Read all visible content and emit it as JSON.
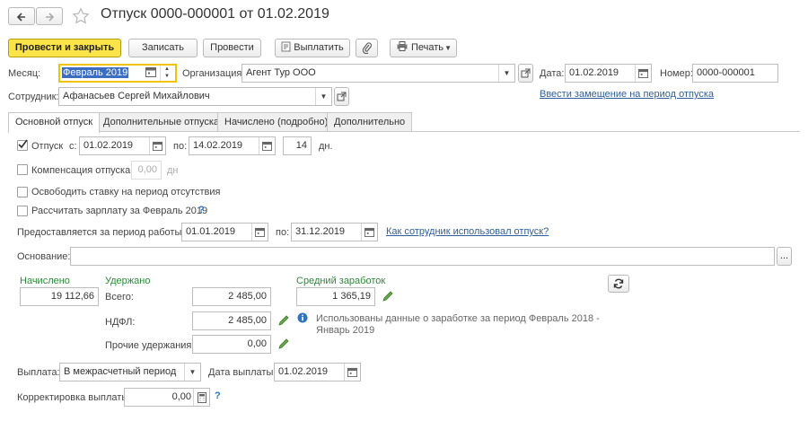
{
  "header": {
    "title": "Отпуск 0000-000001 от 01.02.2019",
    "back_icon": "arrow-left-icon",
    "forward_icon": "arrow-right-icon",
    "star_icon": "star-icon"
  },
  "toolbar": {
    "post_close": "Провести и закрыть",
    "save": "Записать",
    "post": "Провести",
    "pay": "Выплатить",
    "print": "Печать"
  },
  "top": {
    "month_label": "Месяц:",
    "month_value": "Февраль 2019",
    "org_label": "Организация:",
    "org_value": "Агент Тур ООО",
    "date_label": "Дата:",
    "date_value": "01.02.2019",
    "number_label": "Номер:",
    "number_value": "0000-000001",
    "employee_label": "Сотрудник:",
    "employee_value": "Афанасьев Сергей Михайлович",
    "substitution_link": "Ввести замещение на период отпуска"
  },
  "tabs": [
    "Основной отпуск",
    "Дополнительные отпуска",
    "Начислено (подробно)",
    "Дополнительно"
  ],
  "main": {
    "vacation_label": "Отпуск",
    "from_label": "с:",
    "from_value": "01.02.2019",
    "to_label": "по:",
    "to_value": "14.02.2019",
    "days_value": "14",
    "days_unit": "дн.",
    "compensation_label": "Компенсация отпуска",
    "compensation_value": "0,00",
    "compensation_unit": "дн",
    "release_rate_label": "Освободить ставку на период отсутствия",
    "calc_salary_label": "Рассчитать зарплату за Февраль 2019",
    "question_mark": "?",
    "period_label": "Предоставляется за период работы с:",
    "period_from": "01.01.2019",
    "period_to_label": "по:",
    "period_to": "31.12.2019",
    "how_used_link": "Как сотрудник использовал отпуск?",
    "basis_label": "Основание:",
    "basis_value": "",
    "basis_btn": "...",
    "accrued_label": "Начислено",
    "accrued_value": "19 112,66",
    "withheld_label": "Удержано",
    "total_label": "Всего:",
    "total_value": "2 485,00",
    "ndfl_label": "НДФЛ:",
    "ndfl_value": "2 485,00",
    "other_label": "Прочие удержания:",
    "other_value": "0,00",
    "avg_label": "Средний заработок",
    "avg_value": "1 365,19",
    "info_text_1": "Использованы данные о заработке за период Февраль 2018 -",
    "info_text_2": "Январь 2019",
    "payment_label": "Выплата:",
    "payment_value": "В межрасчетный период",
    "pay_date_label": "Дата выплаты:",
    "pay_date_value": "01.02.2019",
    "correction_label": "Корректировка выплаты:",
    "correction_value": "0,00"
  },
  "colors": {
    "primary_button": "#fbe34a",
    "link": "#2f5f9e",
    "green_label": "#2d8a3a",
    "focus_border": "#f0c400"
  }
}
